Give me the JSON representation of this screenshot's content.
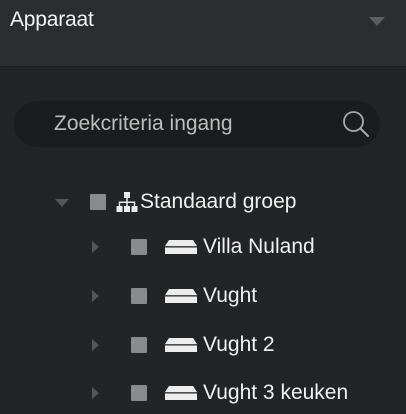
{
  "header": {
    "title": "Apparaat"
  },
  "search": {
    "placeholder": "Zoekcriteria ingang",
    "icon": "search-icon"
  },
  "tree": {
    "root": {
      "label": "Standaard groep",
      "icon": "group-network-icon",
      "expanded": true,
      "checked": false
    },
    "children": [
      {
        "label": "Villa Nuland",
        "icon": "device-icon",
        "expanded": false,
        "checked": false
      },
      {
        "label": "Vught",
        "icon": "device-icon",
        "expanded": false,
        "checked": false
      },
      {
        "label": "Vught 2",
        "icon": "device-icon",
        "expanded": false,
        "checked": false
      },
      {
        "label": "Vught 3 keuken",
        "icon": "device-icon",
        "expanded": false,
        "checked": false
      }
    ]
  }
}
